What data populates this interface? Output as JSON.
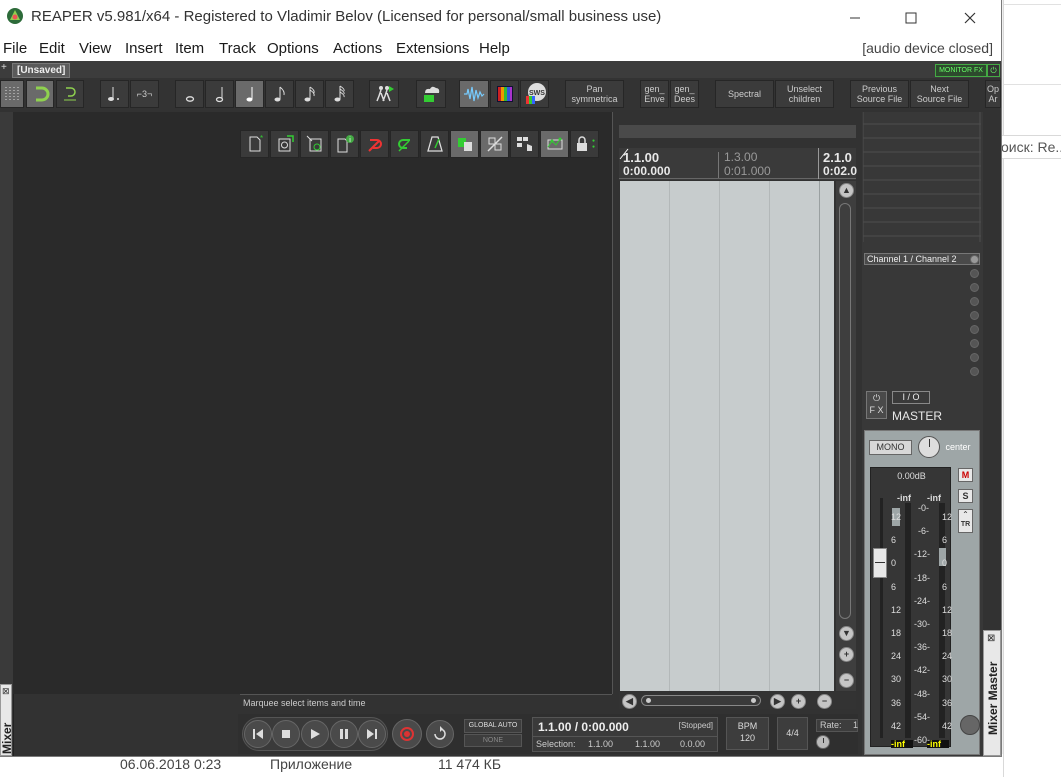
{
  "window": {
    "title": "REAPER v5.981/x64 - Registered to Vladimir Belov (Licensed for personal/small business use)",
    "audio_status": "[audio device closed]"
  },
  "menu": [
    "File",
    "Edit",
    "View",
    "Insert",
    "Item",
    "Track",
    "Options",
    "Actions",
    "Extensions",
    "Help"
  ],
  "project_tab": "[Unsaved]",
  "monitor_fx": "MONITOR FX",
  "toolbar": {
    "pan_symmetrical": [
      "Pan",
      "symmetrica"
    ],
    "gen_env": [
      "gen_",
      "Enve"
    ],
    "gen_dees": [
      "gen_",
      "Dees"
    ],
    "spectral": "Spectral",
    "unselect_children": [
      "Unselect",
      "children"
    ],
    "prev_source": [
      "Previous",
      "Source File"
    ],
    "next_source": [
      "Next",
      "Source File"
    ],
    "op": [
      "Op",
      "Ar"
    ],
    "triplet": "⌐3¬",
    "sws": "SWS"
  },
  "status_line": "Marquee select items and time",
  "ruler": {
    "marks": [
      "1.1.00",
      "1.3.00",
      "2.1.0"
    ],
    "times": [
      "0:00.000",
      "0:01.000",
      "0:02.0"
    ]
  },
  "transport": {
    "global_auto": "GLOBAL AUTO",
    "none": "NONE",
    "position": "1.1.00 / 0:00.000",
    "state": "[Stopped]",
    "selection_label": "Selection:",
    "sel_start": "1.1.00",
    "sel_end": "1.1.00",
    "sel_len": "0.0.00",
    "bpm_label": "BPM",
    "bpm_value": "120",
    "time_sig": "4/4",
    "rate_label": "Rate:",
    "rate_value": "1"
  },
  "master": {
    "channel_label": "Channel 1 / Channel 2",
    "io": "I / O",
    "fx": "F X",
    "name": "MASTER",
    "mono": "MONO",
    "pan": "center",
    "volume": "0.00dB",
    "peak_l": "-inf",
    "peak_r": "-inf",
    "mute": "M",
    "solo": "S",
    "trim": "TR",
    "out_l": "-inf",
    "out_r": "-inf",
    "fader_scale": [
      "12",
      "6",
      "0",
      "6",
      "12",
      "18",
      "24",
      "30",
      "36",
      "42"
    ],
    "meter_scale": [
      "0",
      "6",
      "12",
      "18",
      "24",
      "30",
      "36",
      "42",
      "48",
      "54",
      "60"
    ]
  },
  "mixer_tab": "Mixer",
  "mixer_master_tab": "Mixer Master",
  "background": {
    "search_hint": "оиск: Re...",
    "file_date": "06.06.2018 0:23",
    "file_type": "Приложение",
    "file_size": "11 474 КБ"
  }
}
